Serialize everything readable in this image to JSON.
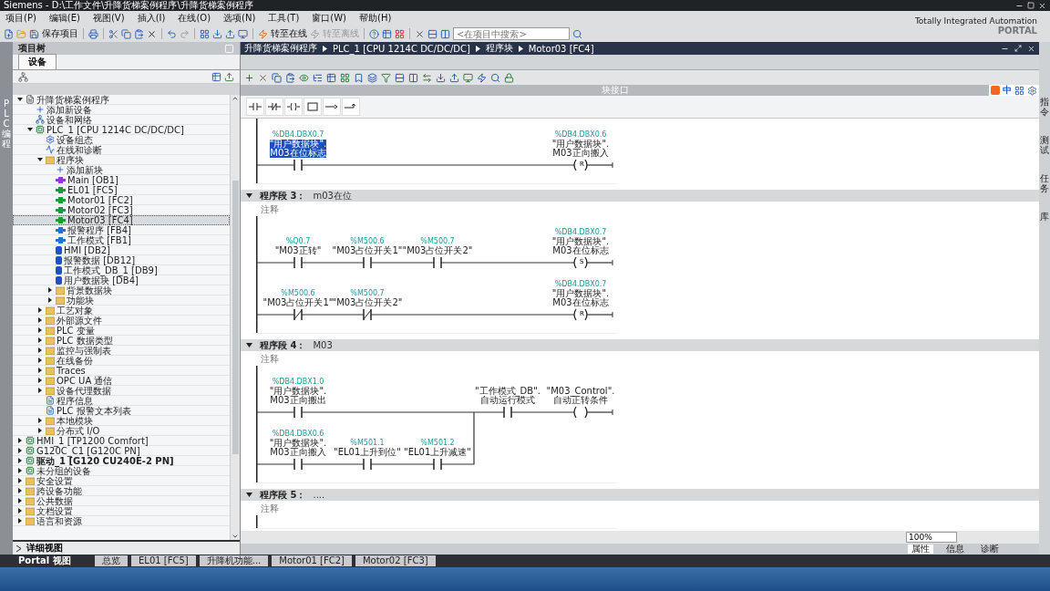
{
  "window": {
    "title": "Siemens  -  D:\\工作文件\\升降货梯案例程序\\升降货梯案例程序"
  },
  "menu": [
    "项目(P)",
    "编辑(E)",
    "视图(V)",
    "插入(I)",
    "在线(O)",
    "选项(N)",
    "工具(T)",
    "窗口(W)",
    "帮助(H)"
  ],
  "toolbar": {
    "save_label": "保存项目",
    "online_label": "转至在线",
    "offline_label": "转至离线",
    "offline_disabled": true,
    "search": {
      "placeholder": "<在项目中搜索>"
    }
  },
  "branding": {
    "line1": "Totally Integrated Automation",
    "line2": "PORTAL"
  },
  "left_strip": {
    "label": "PLC 编程"
  },
  "project_tree": {
    "title": "项目树",
    "tab": "设备",
    "items": [
      {
        "label": "升降货梯案例程序",
        "kind": "project",
        "expanded": true,
        "selected": false,
        "children": [
          {
            "label": "添加新设备",
            "kind": "add",
            "selected": false
          },
          {
            "label": "设备和网络",
            "kind": "network",
            "selected": false
          },
          {
            "label": "PLC_1 [CPU 1214C DC/DC/DC]",
            "kind": "plc",
            "expanded": true,
            "selected": false,
            "children": [
              {
                "label": "设备组态",
                "kind": "config",
                "selected": false
              },
              {
                "label": "在线和诊断",
                "kind": "diag",
                "selected": false
              },
              {
                "label": "程序块",
                "kind": "folder",
                "expanded": true,
                "selected": false,
                "children": [
                  {
                    "label": "添加新块",
                    "kind": "add",
                    "selected": false
                  },
                  {
                    "label": "Main [OB1]",
                    "kind": "ob",
                    "selected": false
                  },
                  {
                    "label": "EL01 [FC5]",
                    "kind": "fc",
                    "selected": false
                  },
                  {
                    "label": "Motor01 [FC2]",
                    "kind": "fc",
                    "selected": false
                  },
                  {
                    "label": "Motor02 [FC3]",
                    "kind": "fc",
                    "selected": false
                  },
                  {
                    "label": "Motor03 [FC4]",
                    "kind": "fc",
                    "selected": true
                  },
                  {
                    "label": "报警程序 [FB4]",
                    "kind": "fb",
                    "selected": false
                  },
                  {
                    "label": "工作模式 [FB1]",
                    "kind": "fb",
                    "selected": false
                  },
                  {
                    "label": "HMI [DB2]",
                    "kind": "db",
                    "selected": false
                  },
                  {
                    "label": "报警数据 [DB12]",
                    "kind": "db",
                    "selected": false
                  },
                  {
                    "label": "工作模式_DB_1 [DB9]",
                    "kind": "db",
                    "selected": false
                  },
                  {
                    "label": "用户数据块 [DB4]",
                    "kind": "db",
                    "selected": false
                  },
                  {
                    "label": "背景数据块",
                    "kind": "folder",
                    "expanded": false,
                    "selected": false
                  },
                  {
                    "label": "功能块",
                    "kind": "folder",
                    "expanded": false,
                    "selected": false
                  }
                ]
              },
              {
                "label": "工艺对象",
                "kind": "folder",
                "expanded": false,
                "selected": false
              },
              {
                "label": "外部源文件",
                "kind": "folder",
                "expanded": false,
                "selected": false
              },
              {
                "label": "PLC 变量",
                "kind": "folder",
                "expanded": false,
                "selected": false
              },
              {
                "label": "PLC 数据类型",
                "kind": "folder",
                "expanded": false,
                "selected": false
              },
              {
                "label": "监控与强制表",
                "kind": "folder",
                "expanded": false,
                "selected": false
              },
              {
                "label": "在线备份",
                "kind": "folder",
                "expanded": false,
                "selected": false
              },
              {
                "label": "Traces",
                "kind": "folder",
                "expanded": false,
                "selected": false
              },
              {
                "label": "OPC UA 通信",
                "kind": "folder",
                "expanded": false,
                "selected": false
              },
              {
                "label": "设备代理数据",
                "kind": "folder",
                "expanded": false,
                "selected": false
              },
              {
                "label": "程序信息",
                "kind": "doc",
                "selected": false
              },
              {
                "label": "PLC 报警文本列表",
                "kind": "doc",
                "selected": false
              },
              {
                "label": "本地模块",
                "kind": "folder",
                "expanded": false,
                "selected": false
              },
              {
                "label": "分布式 I/O",
                "kind": "folder",
                "expanded": false,
                "selected": false
              }
            ]
          }
        ]
      },
      {
        "label": "HMI_1 [TP1200 Comfort]",
        "kind": "device",
        "expanded": false,
        "selected": false
      },
      {
        "label": "G120C_C1 [G120C PN]",
        "kind": "device",
        "expanded": false,
        "selected": false
      },
      {
        "label": "驱动_1 [G120 CU240E-2 PN]",
        "kind": "device",
        "expanded": false,
        "selected": false
      },
      {
        "label": "未分组的设备",
        "kind": "device",
        "expanded": false,
        "selected": false
      },
      {
        "label": "安全设置",
        "kind": "folder",
        "expanded": false,
        "selected": false
      },
      {
        "label": "跨设备功能",
        "kind": "folder",
        "expanded": false,
        "selected": false
      },
      {
        "label": "公共数据",
        "kind": "folder",
        "expanded": false,
        "selected": false
      },
      {
        "label": "文档设置",
        "kind": "folder",
        "expanded": false,
        "selected": false
      },
      {
        "label": "语言和资源",
        "kind": "folder",
        "expanded": false,
        "selected": false
      }
    ],
    "details": "详细视图"
  },
  "editor": {
    "breadcrumb": [
      "升降货梯案例程序",
      "PLC_1 [CPU 1214C DC/DC/DC]",
      "程序块",
      "Motor03 [FC4]"
    ],
    "interface_label": "块接口",
    "ime": {
      "mode": "中"
    },
    "zoom": "100%",
    "networks": [
      {
        "rows": [
          {
            "elements": [
              {
                "kind": "contact",
                "address": "%DB4.DBX0.7",
                "names": [
                  "\"用户数据块\".",
                  "M03在位标志"
                ],
                "selected": true
              },
              {
                "kind": "wire"
              },
              {
                "kind": "wire"
              },
              {
                "kind": "wire"
              },
              {
                "kind": "coil",
                "op": "R",
                "address": "%DB4.DBX0.6",
                "names": [
                  "\"用户数据块\".",
                  "M03正向搬入"
                ],
                "selected": false
              }
            ]
          }
        ]
      },
      {
        "title": "程序段 3：",
        "name": "m03在位",
        "comment": "注释",
        "rows": [
          {
            "elements": [
              {
                "kind": "contact",
                "address": "%Q0.7",
                "names": [
                  "\"M03正转\""
                ],
                "selected": false
              },
              {
                "kind": "contact",
                "address": "%M500.6",
                "names": [
                  "\"M03占位开关1\""
                ],
                "selected": false
              },
              {
                "kind": "contact",
                "address": "%M500.7",
                "names": [
                  "\"M03占位开关2\""
                ],
                "selected": false
              },
              {
                "kind": "wire"
              },
              {
                "kind": "coil",
                "op": "S",
                "address": "%DB4.DBX0.7",
                "names": [
                  "\"用户数据块\".",
                  "M03在位标志"
                ],
                "selected": false
              }
            ]
          },
          {
            "elements": [
              {
                "kind": "nc_contact",
                "address": "%M500.6",
                "names": [
                  "\"M03占位开关1\""
                ],
                "selected": false
              },
              {
                "kind": "nc_contact",
                "address": "%M500.7",
                "names": [
                  "\"M03占位开关2\""
                ],
                "selected": false
              },
              {
                "kind": "wire"
              },
              {
                "kind": "wire"
              },
              {
                "kind": "coil",
                "op": "R",
                "address": "%DB4.DBX0.7",
                "names": [
                  "\"用户数据块\".",
                  "M03在位标志"
                ],
                "selected": false
              }
            ]
          }
        ]
      },
      {
        "title": "程序段 4：",
        "name": "M03",
        "comment": "注释",
        "rows": [
          {
            "elements": [
              {
                "kind": "contact",
                "address": "%DB4.DBX1.0",
                "names": [
                  "\"用户数据块\".",
                  "M03正向搬出"
                ],
                "selected": false
              },
              {
                "kind": "wire"
              },
              {
                "kind": "wire"
              },
              {
                "kind": "contact",
                "names": [
                  "\"工作模式_DB\".",
                  "自动运行模式"
                ],
                "selected": false
              },
              {
                "kind": "coil",
                "names": [
                  "\"M03_Control\".",
                  "自动正转条件"
                ],
                "selected": false
              }
            ]
          },
          {
            "branch": true,
            "elements": [
              {
                "kind": "contact",
                "address": "%DB4.DBX0.6",
                "names": [
                  "\"用户数据块\".",
                  "M03正向搬入"
                ],
                "selected": false
              },
              {
                "kind": "contact",
                "address": "%M501.1",
                "names": [
                  "\"EL01上升到位\""
                ],
                "selected": false
              },
              {
                "kind": "contact",
                "address": "%M501.2",
                "names": [
                  "\"EL01上升减速\""
                ],
                "selected": false
              }
            ]
          }
        ]
      },
      {
        "title": "程序段 5：",
        "name": "....",
        "comment": "注释"
      }
    ]
  },
  "right_tabs": [
    "指令",
    "测试",
    "任务",
    "库"
  ],
  "inspector_tabs": [
    {
      "label": "属性",
      "selected": true
    },
    {
      "label": "信息",
      "selected": false
    },
    {
      "label": "诊断",
      "selected": false
    }
  ],
  "taskbar": {
    "portal": "Portal 视图",
    "tabs": [
      "总览",
      "EL01 [FC5]",
      "升降机功能...",
      "Motor01 [FC2]",
      "Motor02 [FC3]"
    ]
  }
}
